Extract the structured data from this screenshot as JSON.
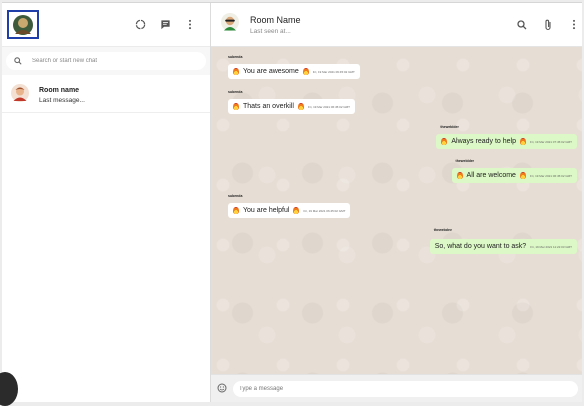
{
  "sidebar": {
    "icons": [
      "status-icon",
      "chat-icon",
      "more-vert-icon"
    ],
    "search": {
      "placeholder": "Search or start new chat"
    },
    "chats": [
      {
        "name": "Room name",
        "last_message": "Last message..."
      }
    ]
  },
  "header": {
    "room_name": "Room Name",
    "last_seen": "Last seen at...",
    "icons": [
      "search-icon",
      "attach-icon",
      "more-vert-icon"
    ]
  },
  "messages": [
    {
      "sender": "subenda",
      "text": "You are awesome",
      "time": "Fri, 19 Mar 2021 06:45:02 GMT",
      "mine": false
    },
    {
      "sender": "subenda",
      "text": "Thats an overkill",
      "time": "Fri, 19 Mar 2021 06:45:02 GMT",
      "mine": false
    },
    {
      "sender": "theweblder",
      "text": "Always ready to help",
      "time": "Fri, 19 Mar 2021 07:45:02 GMT",
      "mine": true
    },
    {
      "sender": "theweblder",
      "text": "All are welcome",
      "time": "Fri, 19 Mar 2021 06:45:02 GMT",
      "mine": true
    },
    {
      "sender": "subenda",
      "text": "You are helpful",
      "time": "Fri, 19 Mar 2021 06:45:02 GMT",
      "mine": false
    },
    {
      "sender": "thewebdev",
      "text": "So, what do you want to ask?",
      "time": "Fri, 19 Mar 2021 11:22:03 GMT",
      "mine": true
    }
  ],
  "footer": {
    "placeholder": "Type a message"
  },
  "colors": {
    "outgoing_bubble": "#dcf8c6",
    "incoming_bubble": "#ffffff",
    "chat_background": "#e6ddd4",
    "avatar_border": "#1f3ea8"
  }
}
